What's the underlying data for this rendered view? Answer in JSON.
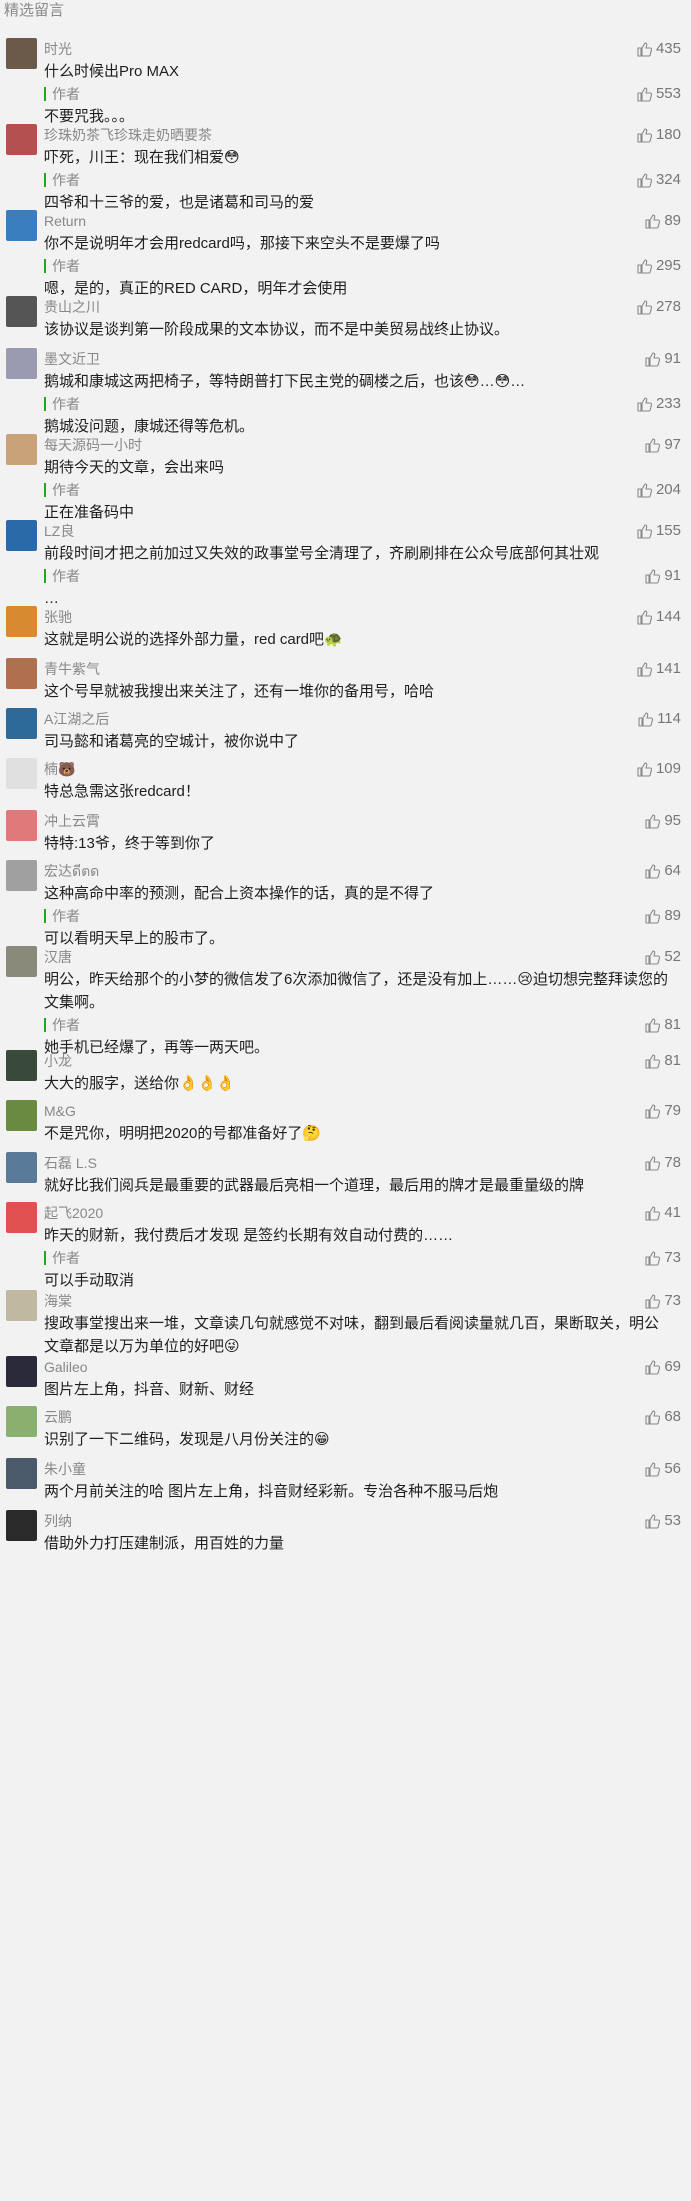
{
  "section_title": "精选留言",
  "author_label": "作者",
  "comments": [
    {
      "nick": "时光",
      "text": "什么时候出Pro MAX",
      "likes": "435",
      "avatar_color": "#6b5a4a",
      "reply": {
        "text": "不要咒我。。。",
        "likes": "553"
      }
    },
    {
      "nick": "珍珠奶茶飞珍珠走奶晒要茶",
      "text": "吓死，川王：现在我们相爱😳",
      "likes": "180",
      "avatar_color": "#b45050",
      "reply": {
        "text": "四爷和十三爷的爱，也是诸葛和司马的爱",
        "likes": "324"
      }
    },
    {
      "nick": "Return",
      "text": "你不是说明年才会用redcard吗，那接下来空头不是要爆了吗",
      "likes": "89",
      "avatar_color": "#3a7ec0",
      "reply": {
        "text": "嗯，是的，真正的RED CARD，明年才会使用",
        "likes": "295"
      }
    },
    {
      "nick": "贵山之川",
      "text": "该协议是谈判第一阶段成果的文本协议，而不是中美贸易战终止协议。",
      "likes": "278",
      "avatar_color": "#555555"
    },
    {
      "nick": "墨文近卫",
      "text": "鹅城和康城这两把椅子，等特朗普打下民主党的碉楼之后，也该😳…😳…",
      "likes": "91",
      "avatar_color": "#9a9ab0",
      "reply": {
        "text": "鹅城没问题，康城还得等危机。",
        "likes": "233"
      }
    },
    {
      "nick": "每天源码一小时",
      "text": "期待今天的文章，会出来吗",
      "likes": "97",
      "avatar_color": "#c9a27a",
      "reply": {
        "text": "正在准备码中",
        "likes": "204"
      }
    },
    {
      "nick": "LZ良",
      "text": "前段时间才把之前加过又失效的政事堂号全清理了，齐刷刷排在公众号底部何其壮观",
      "likes": "155",
      "avatar_color": "#2a6aa8",
      "reply": {
        "text": "…",
        "likes": "91"
      }
    },
    {
      "nick": "张驰",
      "text": "这就是明公说的选择外部力量，red card吧🐢",
      "likes": "144",
      "avatar_color": "#d88a30"
    },
    {
      "nick": "青牛紫气",
      "text": "这个号早就被我搜出来关注了，还有一堆你的备用号，哈哈",
      "likes": "141",
      "avatar_color": "#b07050"
    },
    {
      "nick": "A江湖之后",
      "text": "司马懿和诸葛亮的空城计，被你说中了",
      "likes": "114",
      "avatar_color": "#2d6a9a"
    },
    {
      "nick": "楠🐻",
      "text": "特总急需这张redcard！",
      "likes": "109",
      "avatar_color": "#e0e0e0"
    },
    {
      "nick": "冲上云霄",
      "text": "特特:13爷，终于等到你了",
      "likes": "95",
      "avatar_color": "#e07a7a"
    },
    {
      "nick": "宏达ดีตด",
      "text": "这种高命中率的预测，配合上资本操作的话，真的是不得了",
      "likes": "64",
      "avatar_color": "#a0a0a0",
      "reply": {
        "text": "可以看明天早上的股市了。",
        "likes": "89"
      }
    },
    {
      "nick": "汉唐",
      "text": "明公，昨天给那个的小梦的微信发了6次添加微信了，还是没有加上……😢迫切想完整拜读您的文集啊。",
      "likes": "52",
      "avatar_color": "#8a8a7a",
      "reply": {
        "text": "她手机已经爆了，再等一两天吧。",
        "likes": "81"
      }
    },
    {
      "nick": "小龙",
      "text": "大大的服字，送给你👌👌👌",
      "likes": "81",
      "avatar_color": "#3a4a3a"
    },
    {
      "nick": "M&G",
      "text": "不是咒你，明明把2020的号都准备好了🤔",
      "likes": "79",
      "avatar_color": "#6a8a40"
    },
    {
      "nick": "石磊 L.S",
      "text": "就好比我们阅兵是最重要的武器最后亮相一个道理，最后用的牌才是最重量级的牌",
      "likes": "78",
      "avatar_color": "#5a7a9a"
    },
    {
      "nick": "起飞2020",
      "text": "昨天的财新，我付费后才发现 是签约长期有效自动付费的……",
      "likes": "41",
      "avatar_color": "#e05050",
      "reply": {
        "text": "可以手动取消",
        "likes": "73"
      }
    },
    {
      "nick": "海棠",
      "text": "搜政事堂搜出来一堆，文章读几句就感觉不对味，翻到最后看阅读量就几百，果断取关，明公文章都是以万为单位的好吧😜",
      "likes": "73",
      "avatar_color": "#c0b8a0"
    },
    {
      "nick": "Galileo",
      "text": "图片左上角，抖音、财新、财经",
      "likes": "69",
      "avatar_color": "#2a2a3a"
    },
    {
      "nick": "云鹏",
      "text": "识别了一下二维码，发现是八月份关注的😁",
      "likes": "68",
      "avatar_color": "#8ab070"
    },
    {
      "nick": "朱小童",
      "text": "两个月前关注的哈 图片左上角，抖音财经彩新。专治各种不服马后炮",
      "likes": "56",
      "avatar_color": "#4a5a6a"
    },
    {
      "nick": "列纳",
      "text": "借助外力打压建制派，用百姓的力量",
      "likes": "53",
      "avatar_color": "#2a2a2a"
    }
  ]
}
